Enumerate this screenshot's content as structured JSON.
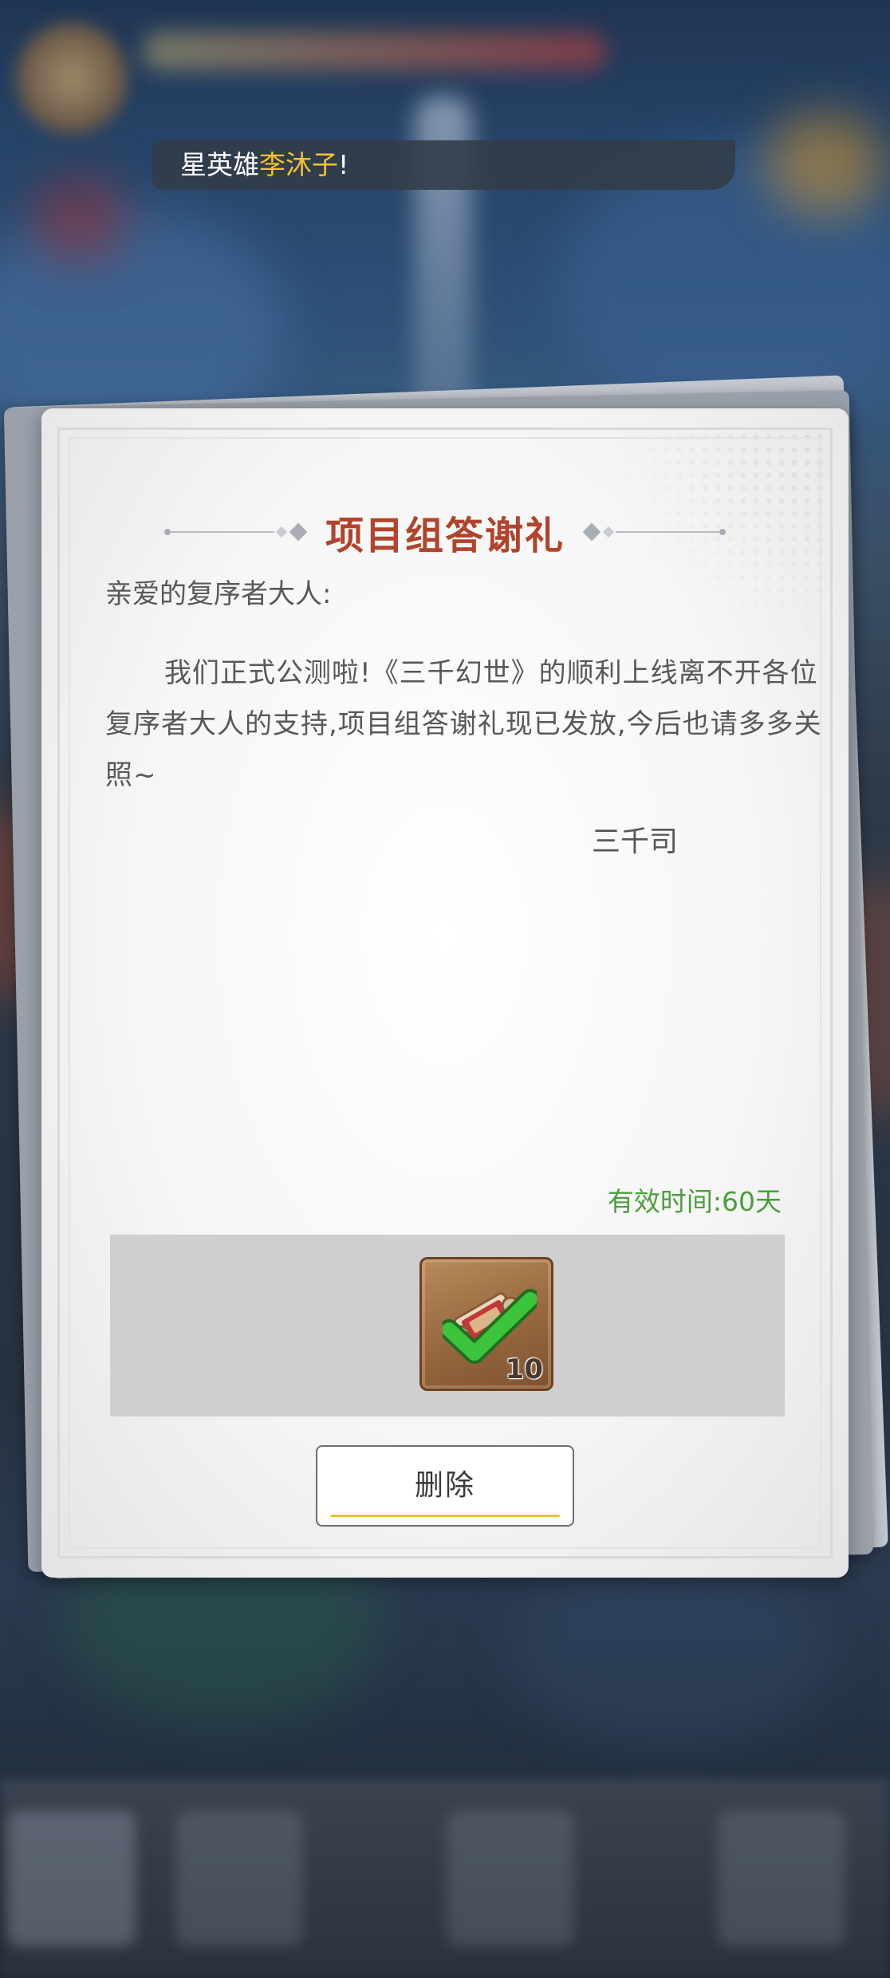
{
  "marquee": {
    "prefix": "星英雄",
    "highlight": "李沐子",
    "suffix": "!"
  },
  "mail": {
    "title": "项目组答谢礼",
    "greeting": "亲爱的复序者大人:",
    "body": "我们正式公测啦!《三千幻世》的顺利上线离不开各位复序者大人的支持,项目组答谢礼现已发放,今后也请多多关照~",
    "signature": "三千司",
    "validity_label": "有效时间:",
    "validity_value": "60天"
  },
  "attachment": {
    "items": [
      {
        "icon": "scroll-item-icon",
        "count": "10",
        "claimed": true
      }
    ]
  },
  "actions": {
    "delete_label": "删除"
  },
  "colors": {
    "title": "#b1442c",
    "validity": "#4aa03a",
    "marquee_highlight": "#f4c42e",
    "button_underline": "#f2c230"
  }
}
